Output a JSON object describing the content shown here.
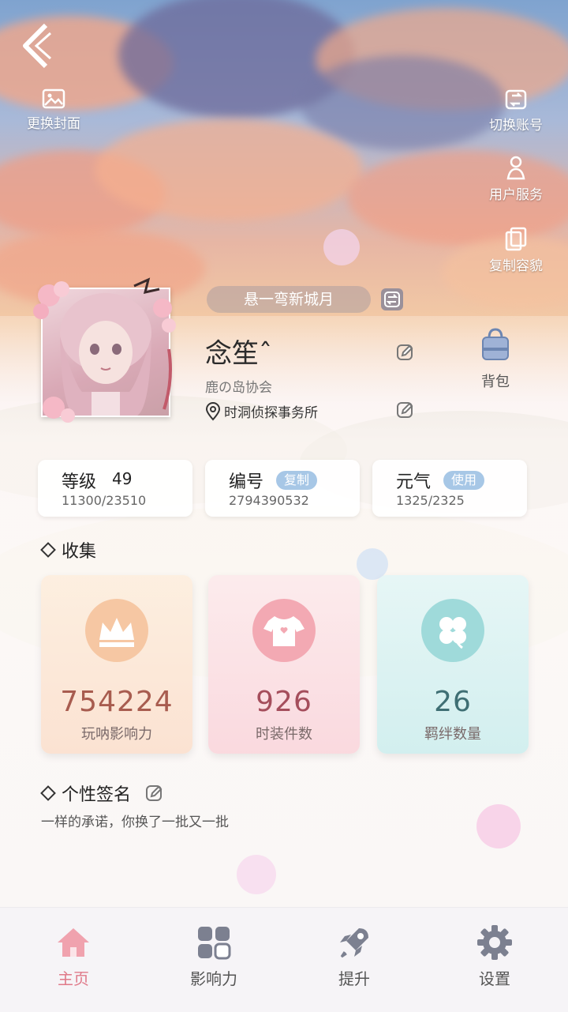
{
  "top_left": {
    "change_cover_label": "更换封面"
  },
  "top_right": {
    "switch_account_label": "切换账号",
    "user_service_label": "用户服务",
    "copy_look_label": "复制容貌"
  },
  "profile": {
    "title": "悬一弯新城月",
    "name": "念笙ˆ",
    "club": "鹿の岛协会",
    "location": "时洞侦探事务所",
    "bag_label": "背包"
  },
  "stats": {
    "level": {
      "label": "等级",
      "value": "49",
      "sub": "11300/23510"
    },
    "id": {
      "label": "编号",
      "chip": "复制",
      "sub": "2794390532"
    },
    "energy": {
      "label": "元气",
      "chip": "使用",
      "sub": "1325/2325"
    }
  },
  "collection": {
    "title": "收集",
    "cards": [
      {
        "value": "754224",
        "caption": "玩呐影响力",
        "icon": "crown-icon",
        "color": "#a85c4f"
      },
      {
        "value": "926",
        "caption": "时装件数",
        "icon": "shirt-icon",
        "color": "#a54e5c"
      },
      {
        "value": "26",
        "caption": "羁绊数量",
        "icon": "clover-icon",
        "color": "#3f6f74"
      }
    ]
  },
  "signature": {
    "title": "个性签名",
    "text": "一样的承诺，你换了一批又一批"
  },
  "nav": {
    "items": [
      {
        "label": "主页",
        "icon": "home-icon",
        "active": true
      },
      {
        "label": "影响力",
        "icon": "grid-icon",
        "active": false
      },
      {
        "label": "提升",
        "icon": "rocket-icon",
        "active": false
      },
      {
        "label": "设置",
        "icon": "gear-icon",
        "active": false
      }
    ],
    "active_color": "#e07a8a"
  }
}
